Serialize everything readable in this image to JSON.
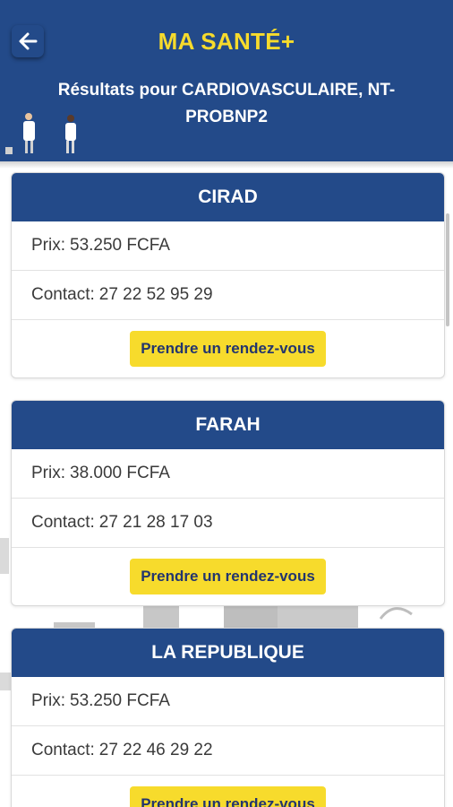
{
  "header": {
    "title": "MA SANTÉ+",
    "subtitle": "Résultats pour CARDIOVASCULAIRE, NT-PROBNP2",
    "back_icon": "arrow-left-icon",
    "colors": {
      "bar": "#234a89",
      "title": "#f7db2c"
    }
  },
  "labels": {
    "price": "Prix:",
    "contact": "Contact:"
  },
  "results": [
    {
      "name": "CIRAD",
      "price": "53.250 FCFA",
      "contact": "27 22 52 95 29",
      "button": "Prendre un rendez-vous"
    },
    {
      "name": "FARAH",
      "price": "38.000 FCFA",
      "contact": "27 21 28 17 03",
      "button": "Prendre un rendez-vous"
    },
    {
      "name": "LA REPUBLIQUE",
      "price": "53.250 FCFA",
      "contact": "27 22 46 29 22",
      "button": "Prendre un rendez-vous"
    }
  ],
  "colors": {
    "button": "#f7db2c",
    "button_text": "#23356e"
  }
}
